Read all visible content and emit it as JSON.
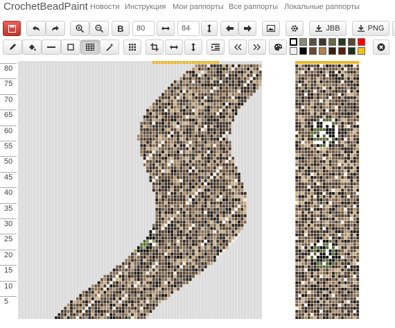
{
  "nav": {
    "brand": "CrochetBeadPaint",
    "links": [
      "Новости",
      "Инструкция",
      "Мои раппорты",
      "Все раппорты",
      "Локальные раппорты"
    ]
  },
  "toolbar": {
    "bold_label": "B",
    "width_value": "80",
    "height_value": "84",
    "jbb_label": "JBB",
    "png_label": "PNG"
  },
  "palette": {
    "colors": [
      "#ffffff",
      "#8a8a7a",
      "#5a5040",
      "#3a3830",
      "#6a6a40",
      "#2a3a20",
      "#5a4838",
      "#ff0000",
      "#f0f0f0",
      "#000000",
      "#6a4a30",
      "#b08050",
      "#3a1c10",
      "#5a2010",
      "#203020",
      "#f0c020"
    ]
  },
  "ruler": {
    "labels": [
      "80",
      "75",
      "70",
      "65",
      "60",
      "55",
      "50",
      "45",
      "40",
      "35",
      "30",
      "25",
      "20",
      "15",
      "10",
      "5"
    ]
  },
  "colors": {
    "grid_empty": "#dcdcdc",
    "gold": "#e8b830",
    "danger": "#d9534f"
  }
}
